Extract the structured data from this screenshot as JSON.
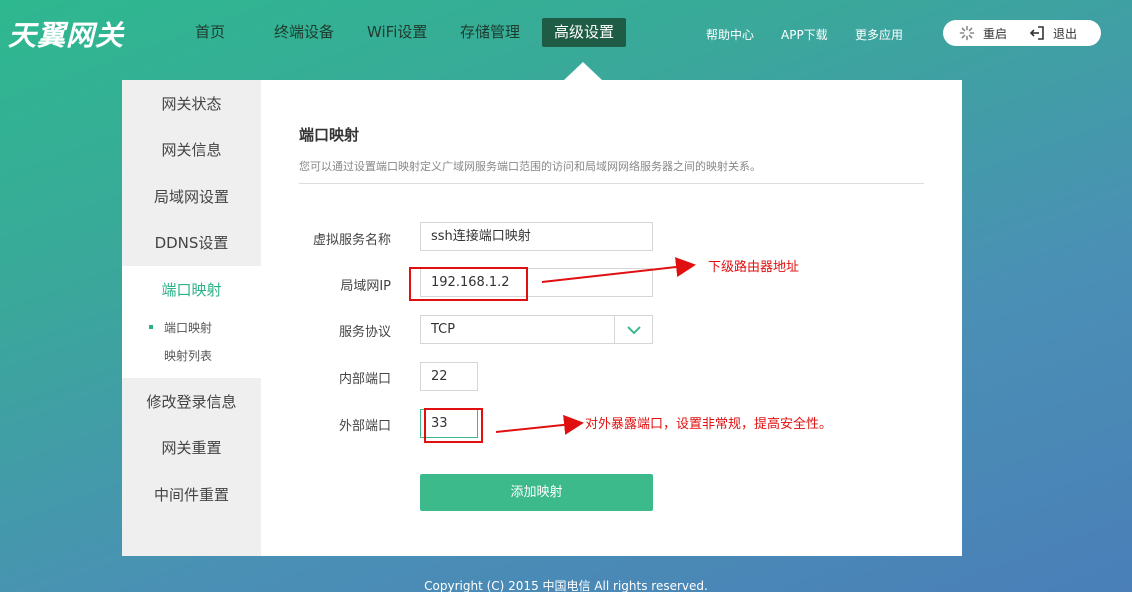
{
  "brand": {
    "logo_text": "天翼网关"
  },
  "nav": {
    "items": [
      {
        "label": "首页"
      },
      {
        "label": "终端设备"
      },
      {
        "label": "WiFi设置"
      },
      {
        "label": "存储管理"
      },
      {
        "label": "高级设置",
        "active": true
      }
    ]
  },
  "top_links": {
    "help": "帮助中心",
    "app": "APP下载",
    "more": "更多应用"
  },
  "pill": {
    "restart": "重启",
    "logout": "退出"
  },
  "sidebar": {
    "items": [
      "网关状态",
      "网关信息",
      "局域网设置",
      "DDNS设置",
      "端口映射",
      "修改登录信息",
      "网关重置",
      "中间件重置"
    ],
    "subitems": [
      "端口映射",
      "映射列表"
    ]
  },
  "section": {
    "title": "端口映射",
    "desc": "您可以通过设置端口映射定义广域网服务端口范围的访问和局域网网络服务器之间的映射关系。"
  },
  "form": {
    "service_name": {
      "label": "虚拟服务名称",
      "value": "ssh连接端口映射"
    },
    "lan_ip": {
      "label": "局域网IP",
      "value": "192.168.1.2"
    },
    "protocol": {
      "label": "服务协议",
      "value": "TCP"
    },
    "internal_port": {
      "label": "内部端口",
      "value": "22"
    },
    "external_port": {
      "label": "外部端口",
      "value": "33"
    },
    "submit": "添加映射"
  },
  "annotations": {
    "ip_note": "下级路由器地址",
    "port_note": "对外暴露端口，设置非常规，提高安全性。",
    "color": "#e01010"
  },
  "footer": {
    "copyright": "Copyright (C) 2015 中国电信 All rights reserved."
  },
  "colors": {
    "accent": "#3dba8c",
    "nav_active": "#1f5c45"
  }
}
